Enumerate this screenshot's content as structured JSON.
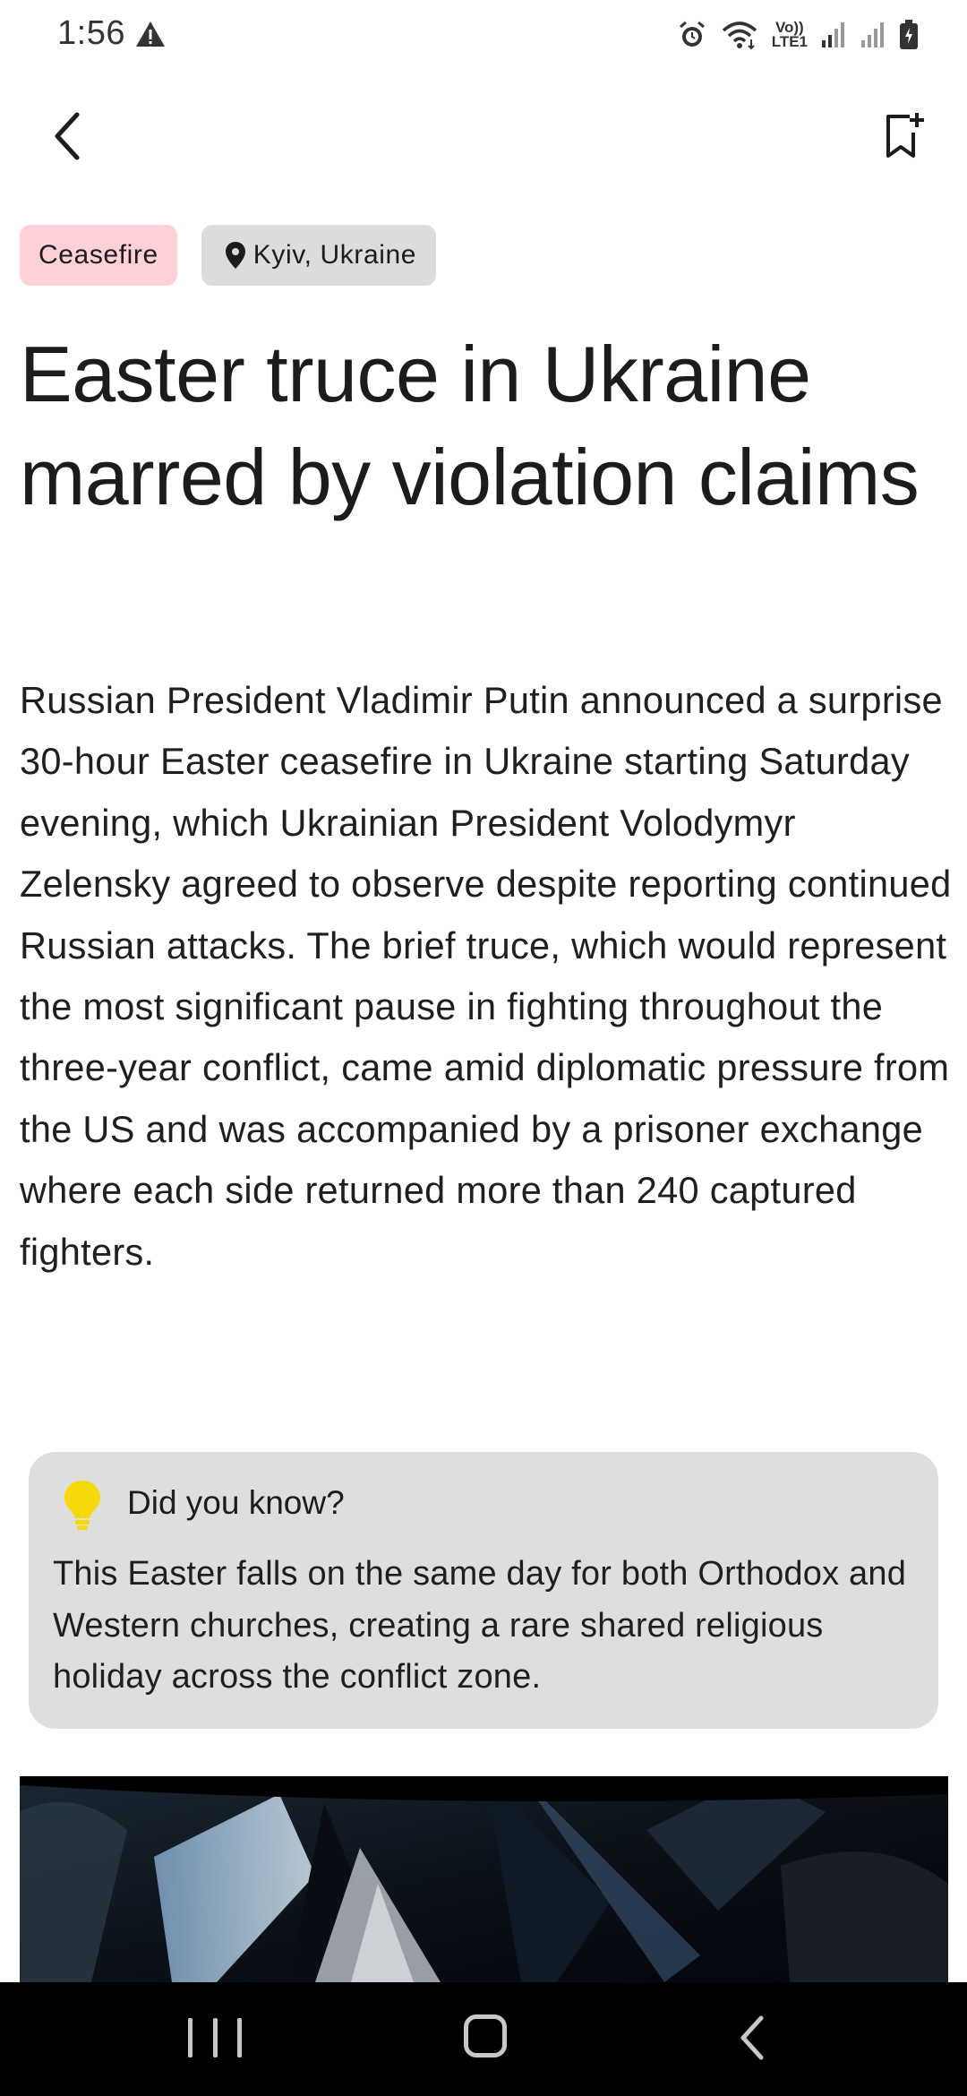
{
  "status_bar": {
    "time": "1:56",
    "network_label": "Vo))\nLTE1"
  },
  "app_bar": {
    "back_icon": "chevron-left-icon",
    "bookmark_icon": "bookmark-add-icon"
  },
  "chips": {
    "topic": "Ceasefire",
    "location": "Kyiv, Ukraine"
  },
  "article": {
    "headline": "Easter truce in Ukraine marred by violation claims",
    "body": "Russian President Vladimir Putin announced a surprise 30-hour Easter ceasefire in Ukraine starting Saturday evening, which Ukrainian President Volodymyr Zelensky agreed to observe despite reporting continued Russian attacks. The brief truce, which would represent the most significant pause in fighting throughout the three-year conflict, came amid diplomatic pressure from the US and was accompanied by a prisoner exchange where each side returned more than 240 captured fighters."
  },
  "fact_card": {
    "title": "Did you know?",
    "text": "This Easter falls on the same day for both Orthodox and Western churches, creating a rare shared religious holiday across the conflict zone.",
    "icon": "lightbulb-icon",
    "icon_color": "#f5d90a"
  },
  "colors": {
    "topic_chip": "#ffd1d6",
    "location_chip": "#dcdcdc",
    "card_background": "#dedede"
  }
}
